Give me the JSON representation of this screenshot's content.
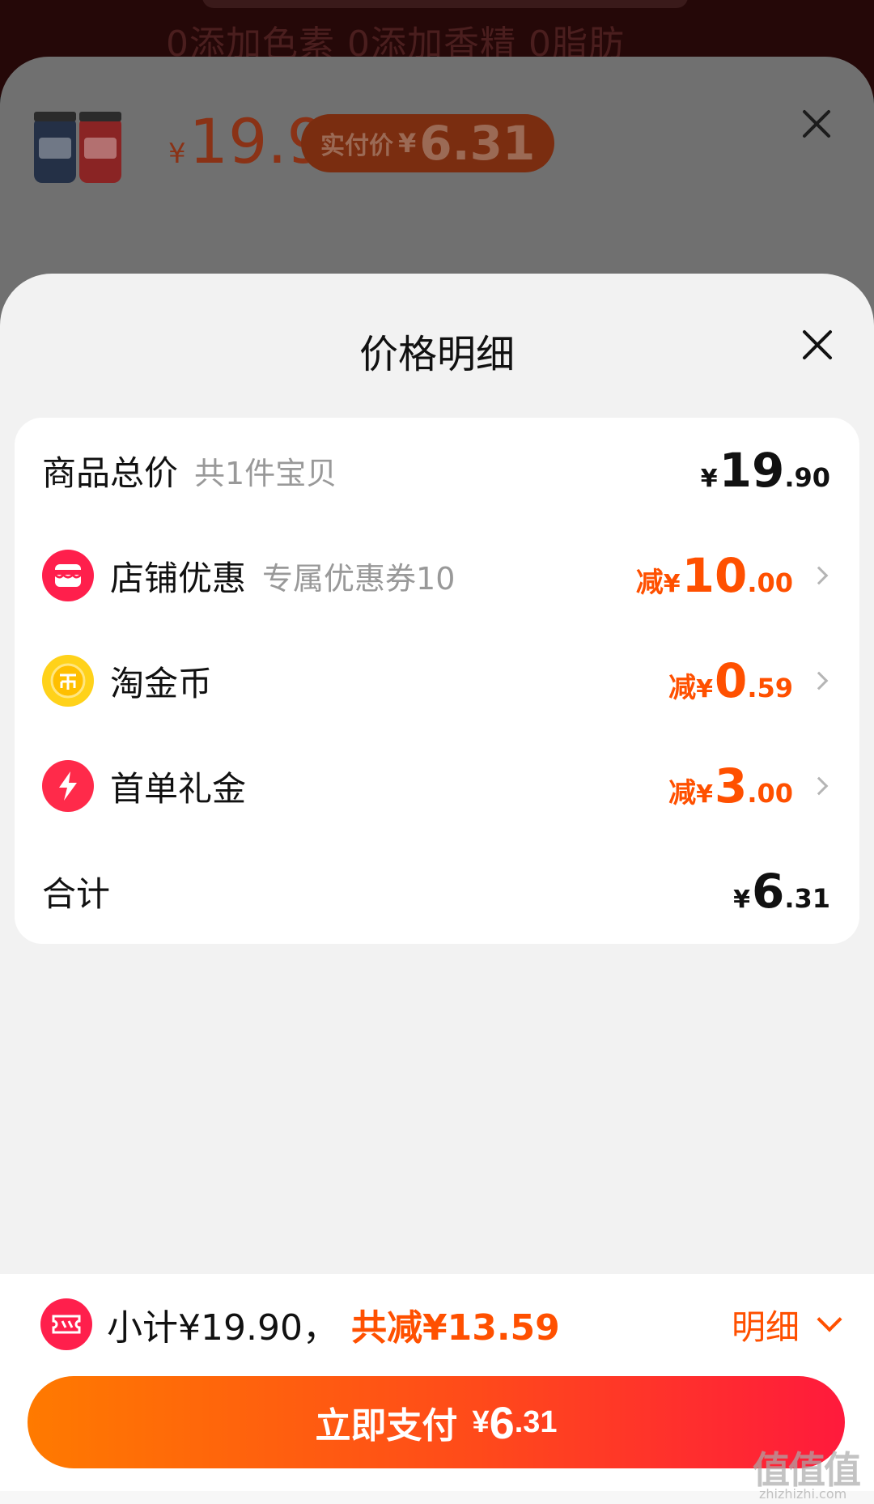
{
  "background": {
    "tagline": "0添加色素 0添加香精 0脂肪"
  },
  "product_sheet": {
    "currency": "¥",
    "original_price": "19.9",
    "real_pay_label": "实付价",
    "real_pay_currency": "¥",
    "real_pay_price": "6.31"
  },
  "detail_sheet": {
    "title": "价格明细",
    "rows": [
      {
        "label": "商品总价",
        "sub": "共1件宝贝",
        "prefix": "",
        "currency": "¥",
        "int": "19",
        "dec": ".90",
        "color": "#111111"
      },
      {
        "label": "店铺优惠",
        "sub": "专属优惠券10",
        "prefix": "减",
        "currency": "¥",
        "int": "10",
        "dec": ".00",
        "icon": "shop-icon",
        "color": "#ff5000"
      },
      {
        "label": "淘金币",
        "prefix": "减",
        "currency": "¥",
        "int": "0",
        "dec": ".59",
        "icon": "coin-icon",
        "color": "#ff5000"
      },
      {
        "label": "首单礼金",
        "prefix": "减",
        "currency": "¥",
        "int": "3",
        "dec": ".00",
        "icon": "lightning-icon",
        "color": "#ff5000"
      },
      {
        "label": "合计",
        "currency": "¥",
        "int": "6",
        "dec": ".31",
        "color": "#111111"
      }
    ]
  },
  "bottom_bar": {
    "subtotal": "小计¥19.90，",
    "total_discount": "共减¥13.59",
    "detail_toggle": "明细",
    "pay_label": "立即支付",
    "pay_currency": "¥",
    "pay_int": "6",
    "pay_dec": ".31"
  },
  "watermark": {
    "big": "值值值",
    "small": "zhizhizhi.com"
  },
  "colors": {
    "accent": "#ff5000",
    "pay_gradient_start": "#ff7a00",
    "pay_gradient_end": "#ff1a3c",
    "shop_icon_bg": "#ff1f4c",
    "coin_icon_bg": "#ffd21a",
    "lightning_icon_bg": "#ff2a4a"
  }
}
